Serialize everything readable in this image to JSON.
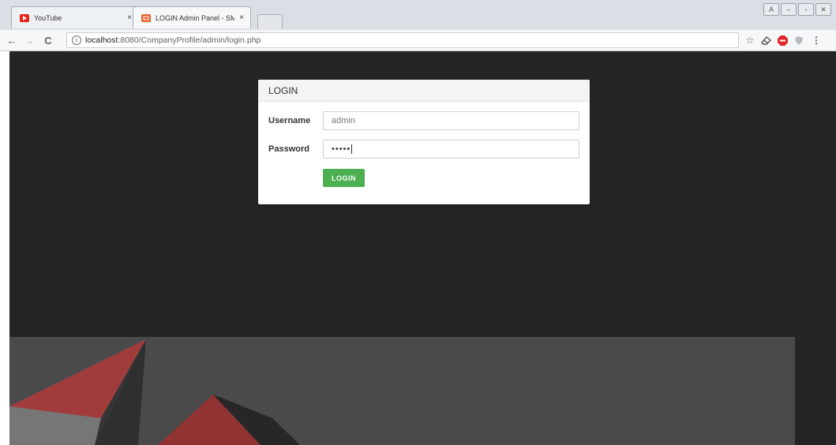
{
  "browser": {
    "tabs": [
      {
        "title": "YouTube",
        "close": "×",
        "favicon_color": "#e62117",
        "active": false
      },
      {
        "title": "LOGIN Admin Panel - SMF",
        "close": "×",
        "favicon_color": "#e8612c",
        "active": true
      }
    ],
    "address": {
      "host": "localhost",
      "path": ":8080/CompanyProfile/admin/login.php"
    },
    "nav": {
      "back": "←",
      "forward": "→",
      "reload": "C",
      "info": "i"
    },
    "window_buttons": [
      "A",
      "–",
      "▫",
      "✕"
    ],
    "toolbar_icons": [
      "star-icon",
      "eraser-icon",
      "adblock-icon",
      "shield-icon",
      "menu-icon"
    ]
  },
  "page": {
    "background": "#242424",
    "panel": {
      "heading": "LOGIN",
      "username_label": "Username",
      "username_value": "admin",
      "password_label": "Password",
      "password_value": "•••••",
      "button_label": "LOGIN",
      "button_color": "#4caf50"
    }
  }
}
